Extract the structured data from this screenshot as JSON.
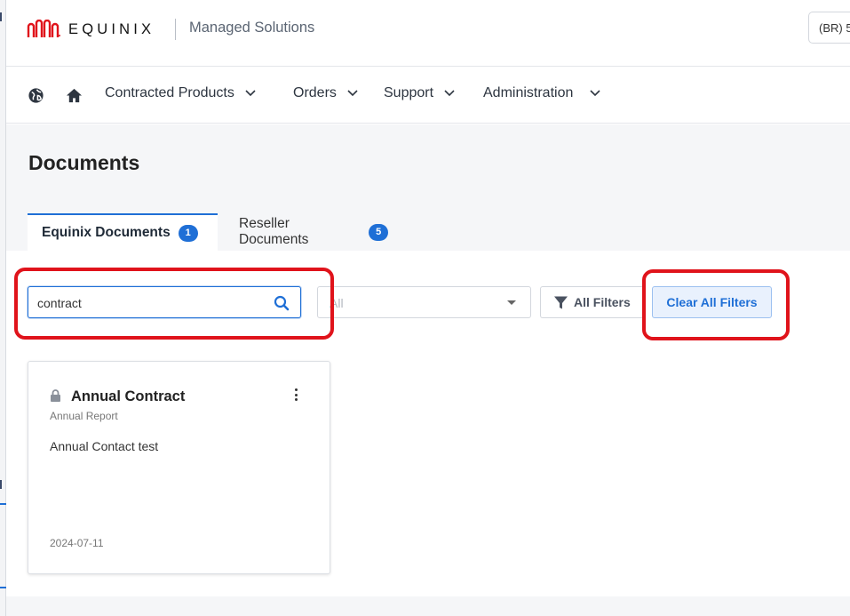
{
  "header": {
    "brand": "EQUINIX",
    "product": "Managed Solutions",
    "region_prefix": "(BR) 5"
  },
  "nav": {
    "items": [
      {
        "label": "Contracted Products"
      },
      {
        "label": "Orders"
      },
      {
        "label": "Support"
      },
      {
        "label": "Administration"
      }
    ]
  },
  "page": {
    "title": "Documents"
  },
  "tabs": [
    {
      "label": "Equinix Documents",
      "count": "1",
      "active": true
    },
    {
      "label": "Reseller Documents",
      "count": "5",
      "active": false
    }
  ],
  "filters": {
    "search_value": "contract",
    "select_value": "All",
    "all_filters_label": "All Filters",
    "clear_label": "Clear All Filters"
  },
  "documents": [
    {
      "title": "Annual Contract",
      "type": "Annual Report",
      "description": "Annual Contact test",
      "date": "2024-07-11"
    }
  ],
  "colors": {
    "brand_red": "#e0131b",
    "accent_blue": "#1f6fd6",
    "highlight_outline": "#e0131b"
  }
}
